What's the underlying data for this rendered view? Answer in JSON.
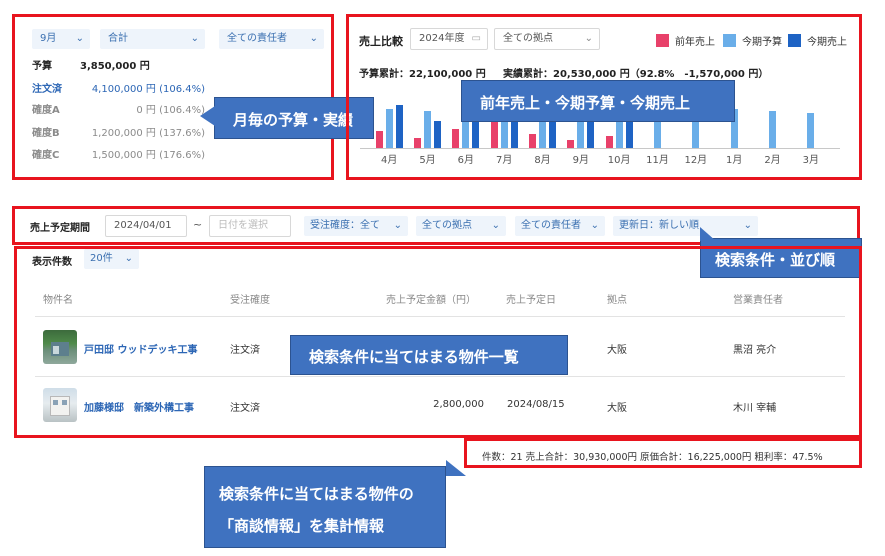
{
  "budget_panel": {
    "month_select": "9月",
    "type_select": "合計",
    "owner_select": "全ての責任者",
    "rows": [
      {
        "label": "予算",
        "value": "3,850,000 円"
      },
      {
        "label": "注文済",
        "value": "4,100,000 円 (106.4%)"
      },
      {
        "label": "確度A",
        "value": "0 円 (106.4%)"
      },
      {
        "label": "確度B",
        "value": "1,200,000 円 (137.6%)"
      },
      {
        "label": "確度C",
        "value": "1,500,000 円 (176.6%)"
      }
    ]
  },
  "callouts": {
    "budget": "月毎の予算・実績",
    "chart": "前年売上・今期予算・今期売上",
    "search": "検索条件・並び順",
    "list": "検索条件に当てはまる物件一覧",
    "summary_line1": "検索条件に当てはまる物件の",
    "summary_line2": "「商談情報」を集計情報"
  },
  "chart_panel": {
    "title": "売上比較",
    "year_select": "2024年度",
    "base_select": "全ての拠点",
    "legend": [
      {
        "name": "前年売上",
        "color": "#e8416a"
      },
      {
        "name": "今期予算",
        "color": "#6aaee9"
      },
      {
        "name": "今期売上",
        "color": "#1e63c4"
      }
    ],
    "summary_budget": "予算累計：22,100,000 円",
    "summary_actual": "実績累計：20,530,000 円（92.8%　-1,570,000 円）"
  },
  "chart_data": {
    "type": "bar",
    "categories": [
      "4月",
      "5月",
      "6月",
      "7月",
      "8月",
      "9月",
      "10月",
      "11月",
      "12月",
      "1月",
      "2月",
      "3月"
    ],
    "series": [
      {
        "name": "前年売上",
        "color": "#e8416a",
        "values": [
          0.45,
          0.25,
          0.5,
          0.7,
          0.35,
          0.2,
          0.3,
          0,
          0,
          0,
          0,
          0
        ]
      },
      {
        "name": "今期予算",
        "color": "#6aaee9",
        "values": [
          1.0,
          0.95,
          1.3,
          1.1,
          1.0,
          1.1,
          1.05,
          1.0,
          1.0,
          1.0,
          0.95,
          0.9
        ]
      },
      {
        "name": "今期売上",
        "color": "#1e63c4",
        "values": [
          1.1,
          0.7,
          1.2,
          1.35,
          1.0,
          1.2,
          0.7,
          0,
          0,
          0,
          0,
          0
        ]
      }
    ],
    "ymax": 1.5,
    "grid": false,
    "legend_position": "top-right"
  },
  "filters": {
    "period_label": "売上予定期間",
    "date_from": "2024/04/01",
    "range_sep": "~",
    "date_to_placeholder": "日付を選択",
    "order_certainty": "受注確度：全て",
    "base": "全ての拠点",
    "owner": "全ての責任者",
    "sort": "更新日：新しい順"
  },
  "list": {
    "page_size_label": "表示件数",
    "page_size": "20件",
    "columns": [
      "物件名",
      "受注確度",
      "売上予定金額（円）",
      "売上予定日",
      "拠点",
      "営業責任者"
    ],
    "rows": [
      {
        "name": "戸田邸 ウッドデッキ工事",
        "certainty": "注文済",
        "amount": "",
        "date": "",
        "base": "大阪",
        "owner": "黒沼 亮介"
      },
      {
        "name": "加藤様邸　新築外構工事",
        "certainty": "注文済",
        "amount": "2,800,000",
        "date": "2024/08/15",
        "base": "大阪",
        "owner": "木川 宰輔"
      }
    ]
  },
  "summary": {
    "text": "件数：21  売上合計：30,930,000円  原価合計：16,225,000円  粗利率：47.5%"
  }
}
